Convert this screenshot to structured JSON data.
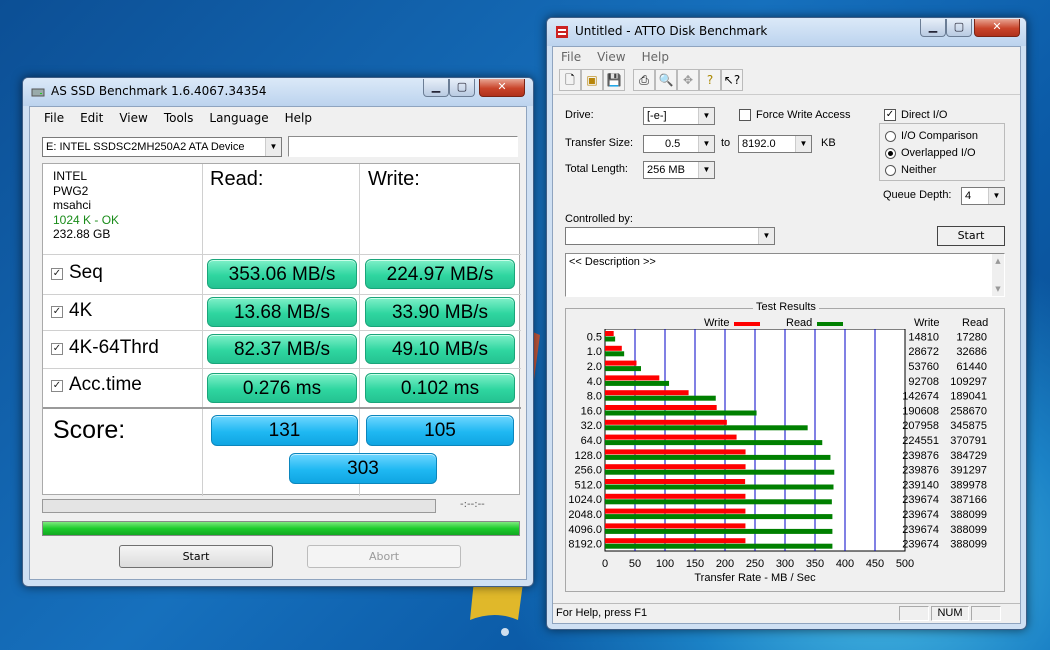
{
  "as_ssd": {
    "title": "AS SSD Benchmark 1.6.4067.34354",
    "menu": [
      "File",
      "Edit",
      "View",
      "Tools",
      "Language",
      "Help"
    ],
    "device": "E: INTEL SSDSC2MH250A2 ATA Device",
    "info": {
      "vendor": "INTEL",
      "firmware": "PWG2",
      "driver": "msahci",
      "alignment": "1024 K - OK",
      "capacity": "232.88 GB"
    },
    "read_header": "Read:",
    "write_header": "Write:",
    "rows": [
      {
        "label": "Seq",
        "read": "353.06 MB/s",
        "write": "224.97 MB/s"
      },
      {
        "label": "4K",
        "read": "13.68 MB/s",
        "write": "33.90 MB/s"
      },
      {
        "label": "4K-64Thrd",
        "read": "82.37 MB/s",
        "write": "49.10 MB/s"
      },
      {
        "label": "Acc.time",
        "read": "0.276 ms",
        "write": "0.102 ms"
      }
    ],
    "score_label": "Score:",
    "score_read": "131",
    "score_write": "105",
    "score_total": "303",
    "elapsed": "-:--:--",
    "progress_fraction": 1.0,
    "start_label": "Start",
    "abort_label": "Abort"
  },
  "atto": {
    "title": "Untitled - ATTO Disk Benchmark",
    "menu": [
      "File",
      "View",
      "Help"
    ],
    "drive_label": "Drive:",
    "drive_value": "[-e-]",
    "force_write_label": "Force Write Access",
    "force_write": false,
    "direct_io_label": "Direct I/O",
    "direct_io": true,
    "transfer_size_label": "Transfer Size:",
    "transfer_from": "0.5",
    "to_label": "to",
    "transfer_to": "8192.0",
    "kb_label": "KB",
    "total_length_label": "Total Length:",
    "total_length": "256 MB",
    "io_modes": [
      "I/O Comparison",
      "Overlapped I/O",
      "Neither"
    ],
    "io_selected": 1,
    "queue_depth_label": "Queue Depth:",
    "queue_depth": "4",
    "controlled_by_label": "Controlled by:",
    "start_label": "Start",
    "description": "<< Description >>",
    "results_title": "Test Results",
    "legend_write": "Write",
    "legend_read": "Read",
    "col_write": "Write",
    "col_read": "Read",
    "status_text": "For Help, press F1",
    "status_num": "NUM",
    "colors": {
      "write": "#ff0000",
      "read": "#008000"
    }
  },
  "chart_data": {
    "type": "bar",
    "title": "Test Results",
    "xlabel": "Transfer Rate - MB / Sec",
    "ylabel": "",
    "xlim": [
      0,
      500
    ],
    "xticks": [
      0,
      50,
      100,
      150,
      200,
      250,
      300,
      350,
      400,
      450,
      500
    ],
    "categories": [
      "0.5",
      "1.0",
      "2.0",
      "4.0",
      "8.0",
      "16.0",
      "32.0",
      "64.0",
      "128.0",
      "256.0",
      "512.0",
      "1024.0",
      "2048.0",
      "4096.0",
      "8192.0"
    ],
    "series": [
      {
        "name": "Write",
        "values": [
          14810,
          28672,
          53760,
          92708,
          142674,
          190608,
          207958,
          224551,
          239876,
          239876,
          239140,
          239674,
          239674,
          239674,
          239674
        ]
      },
      {
        "name": "Read",
        "values": [
          17280,
          32686,
          61440,
          109297,
          189041,
          258670,
          345875,
          370791,
          384729,
          391297,
          389978,
          387166,
          388099,
          388099,
          388099
        ]
      }
    ],
    "value_units": "KB/s",
    "legend": "top-center"
  }
}
